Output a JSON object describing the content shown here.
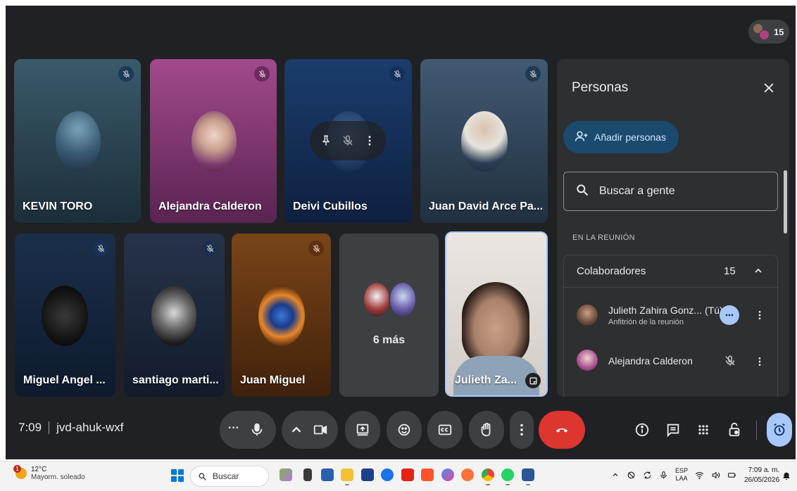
{
  "top_bar": {
    "participant_count": "15"
  },
  "tiles": {
    "kevin": {
      "name": "KEVIN TORO"
    },
    "alejandra": {
      "name": "Alejandra Calderon"
    },
    "deivi": {
      "name": "Deivi Cubillos"
    },
    "juandavid": {
      "name": "Juan David Arce Pa..."
    },
    "miguel": {
      "name": "Miguel Angel ..."
    },
    "santiago": {
      "name": "santiago marti..."
    },
    "juanmiguel": {
      "name": "Juan Miguel"
    },
    "more": {
      "label": "6 más"
    },
    "julieth": {
      "name": "Julieth Za..."
    }
  },
  "panel": {
    "title": "Personas",
    "add_people": "Añadir personas",
    "search_placeholder": "Buscar a gente",
    "section_label": "EN LA REUNIÓN",
    "group_label": "Colaboradores",
    "group_count": "15",
    "people": [
      {
        "name": "Julieth Zahira Gonz... (Tú)",
        "role": "Anfitrión de la reunión"
      },
      {
        "name": "Alejandra Calderon"
      }
    ]
  },
  "meeting": {
    "time": "7:09",
    "code": "jvd-ahuk-wxf"
  },
  "colors": {
    "background": "#202124",
    "panel": "#2d2f31",
    "control": "#3c4043",
    "leave": "#dc362e",
    "accent": "#a8c7fa"
  },
  "controls": {
    "more_dots": "···",
    "icons": [
      "more-options-icon",
      "microphone-icon",
      "chevron-up-icon",
      "camera-icon",
      "present-screen-icon",
      "emoji-icon",
      "captions-icon",
      "raise-hand-icon",
      "leave-call-icon",
      "info-icon",
      "chat-icon",
      "activities-icon",
      "host-controls-icon",
      "timer-icon"
    ]
  },
  "taskbar": {
    "weather_temp": "12°C",
    "weather_desc": "Mayorm. soleado",
    "weather_badge": "1",
    "search_label": "Buscar",
    "lang_1": "ESP",
    "lang_2": "LAA",
    "time": "7:09 a. m.",
    "date": "26/05/2026"
  }
}
